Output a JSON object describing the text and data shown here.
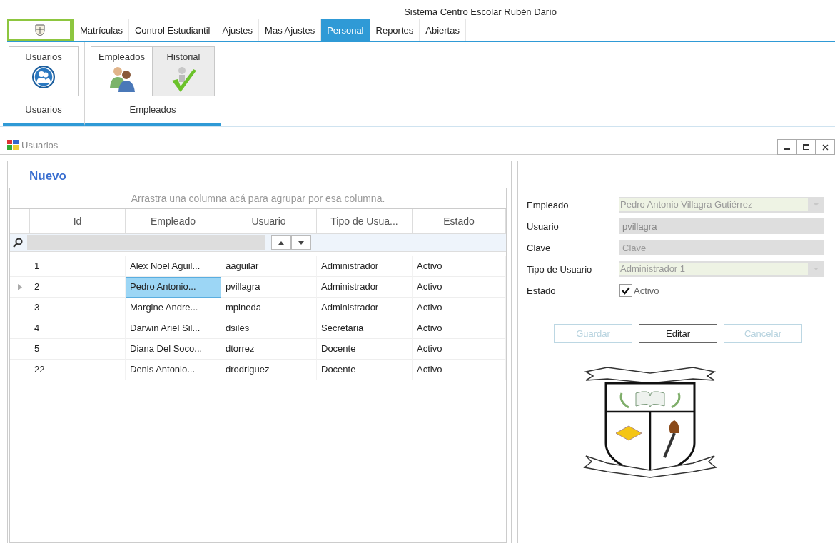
{
  "app_title": "Sistema Centro Escolar Rubén Darío",
  "tabs": [
    {
      "label": "Matrículas",
      "selected": false
    },
    {
      "label": "Control Estudiantil",
      "selected": false
    },
    {
      "label": "Ajustes",
      "selected": false
    },
    {
      "label": "Mas Ajustes",
      "selected": false
    },
    {
      "label": "Personal",
      "selected": true
    },
    {
      "label": "Reportes",
      "selected": false
    },
    {
      "label": "Abiertas",
      "selected": false
    }
  ],
  "ribbon_groups": [
    {
      "label": "Usuarios",
      "buttons": [
        {
          "label": "Usuarios",
          "kind": "users",
          "selected": false
        }
      ]
    },
    {
      "label": "Empleados",
      "buttons": [
        {
          "label": "Empleados",
          "kind": "people",
          "selected": false
        },
        {
          "label": "Historial",
          "kind": "check",
          "selected": true
        }
      ]
    }
  ],
  "window": {
    "title": "Usuarios"
  },
  "heading": "Nuevo",
  "grid": {
    "group_hint": "Arrastra una columna acá para agrupar por esa columna.",
    "columns": [
      "Id",
      "Empleado",
      "Usuario",
      "Tipo de Usua...",
      "Estado"
    ],
    "rows": [
      {
        "cells": [
          "1",
          "Alex Noel Aguil...",
          "aaguilar",
          "Administrador",
          "Activo"
        ],
        "selected": false
      },
      {
        "cells": [
          "2",
          "Pedro Antonio...",
          "pvillagra",
          "Administrador",
          "Activo"
        ],
        "selected": true
      },
      {
        "cells": [
          "3",
          "Margine Andre...",
          "mpineda",
          "Administrador",
          "Activo"
        ],
        "selected": false
      },
      {
        "cells": [
          "4",
          "Darwin Ariel Sil...",
          "dsiles",
          "Secretaria",
          "Activo"
        ],
        "selected": false
      },
      {
        "cells": [
          "5",
          "Diana Del Soco...",
          "dtorrez",
          "Docente",
          "Activo"
        ],
        "selected": false
      },
      {
        "cells": [
          "22",
          "Denis Antonio...",
          "drodriguez",
          "Docente",
          "Activo"
        ],
        "selected": false
      }
    ]
  },
  "form": {
    "fields": [
      {
        "label": "Empleado",
        "kind": "combo",
        "value": "Pedro Antonio Villagra Gutiérrez"
      },
      {
        "label": "Usuario",
        "kind": "text",
        "value": "pvillagra"
      },
      {
        "label": "Clave",
        "kind": "text",
        "placeholder": "Clave"
      },
      {
        "label": "Tipo de Usuario",
        "kind": "combo",
        "value": "Administrador 1"
      },
      {
        "label": "Estado",
        "kind": "checkbox",
        "text": "Activo",
        "checked": true
      }
    ],
    "buttons": [
      {
        "label": "Guardar",
        "disabled": true
      },
      {
        "label": "Editar",
        "disabled": false
      },
      {
        "label": "Cancelar",
        "disabled": true
      }
    ]
  }
}
